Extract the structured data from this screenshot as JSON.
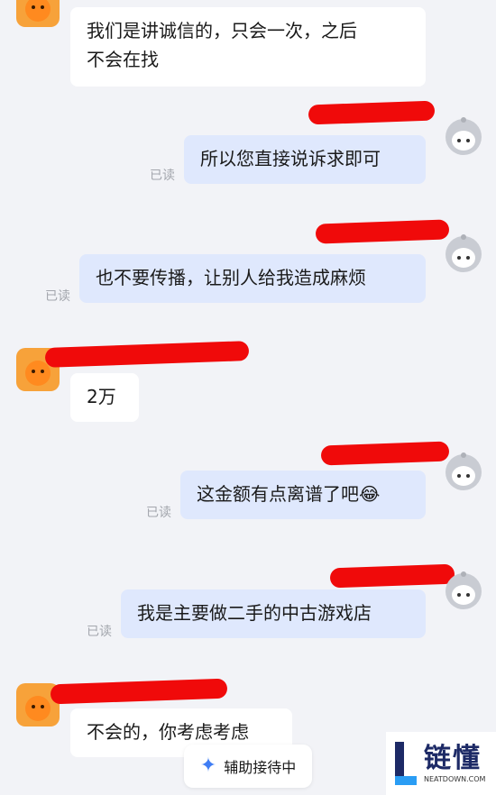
{
  "messages": [
    {
      "id": "m1",
      "side": "in",
      "text_lines": [
        "我们是讲诚信的，只会一次，之后",
        "不会在找"
      ]
    },
    {
      "id": "m2",
      "side": "out",
      "text": "所以您直接说诉求即可",
      "read": "已读"
    },
    {
      "id": "m3",
      "side": "out",
      "text": "也不要传播，让别人给我造成麻烦",
      "read": "已读"
    },
    {
      "id": "m4",
      "side": "in",
      "text": "2万"
    },
    {
      "id": "m5",
      "side": "out",
      "text": "这金额有点离谱了吧😂",
      "read": "已读"
    },
    {
      "id": "m6",
      "side": "out",
      "text": "我是主要做二手的中古游戏店",
      "read": "已读"
    },
    {
      "id": "m7",
      "side": "in",
      "text": "不会的，你考虑考虑"
    }
  ],
  "status_button": {
    "icon": "sparkle-icon",
    "label": "辅助接待中"
  },
  "watermark": {
    "title": "链懂",
    "subtitle": "NEATDOWN.COM"
  },
  "colors": {
    "background": "#f2f3f7",
    "incoming_bubble": "#ffffff",
    "outgoing_bubble": "#dfe8fd",
    "redaction": "#f00a0a",
    "accent": "#3f7df4"
  }
}
